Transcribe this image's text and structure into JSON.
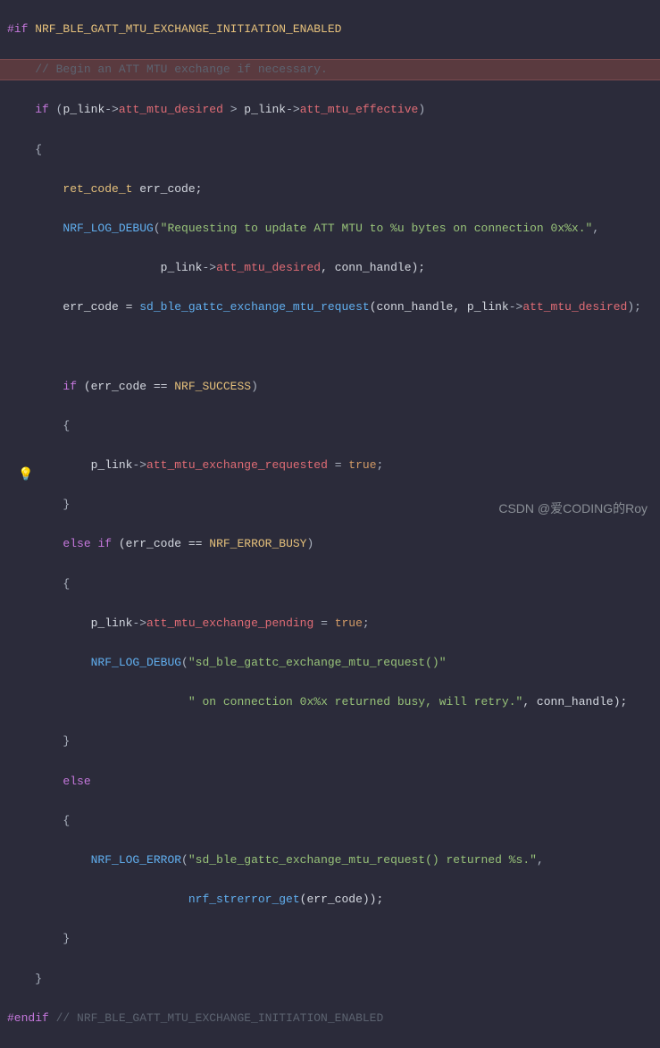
{
  "watermark": "CSDN @爱CODING的Roy",
  "gutter": {
    "bulb": "💡"
  },
  "code": {
    "l1": {
      "pp": "#if",
      "name": " NRF_BLE_GATT_MTU_EXCHANGE_INITIATION_ENABLED"
    },
    "l2": "    // Begin an ATT MTU exchange if necessary.",
    "l3": {
      "kw": "if",
      "open": " (",
      "p1": "p_link",
      "arrow1": "->",
      "m1": "att_mtu_desired",
      "op": " > ",
      "p2": "p_link",
      "arrow2": "->",
      "m2": "att_mtu_effective",
      "close": ")"
    },
    "l4": "    {",
    "l5": {
      "type": "ret_code_t",
      "var": " err_code;"
    },
    "l6": {
      "fn": "NRF_LOG_DEBUG",
      "open": "(",
      "str": "\"Requesting to update ATT MTU to %u bytes on connection 0x%x.\"",
      "comma": ","
    },
    "l7": {
      "p": "p_link",
      "arrow": "->",
      "m": "att_mtu_desired",
      "rest": ", conn_handle);"
    },
    "l8": {
      "lhs": "err_code = ",
      "fn": "sd_ble_gattc_exchange_mtu_request",
      "open": "(conn_handle, ",
      "p": "p_link",
      "arrow": "->",
      "m": "att_mtu_desired",
      "close": ");"
    },
    "l9": "",
    "l10": {
      "kw": "if",
      "open": " (err_code == ",
      "c": "NRF_SUCCESS",
      "close": ")"
    },
    "l11": "        {",
    "l12": {
      "p": "p_link",
      "arrow": "->",
      "m": "att_mtu_exchange_requested",
      "eq": " = ",
      "v": "true",
      "end": ";"
    },
    "l13": "        }",
    "l14": {
      "kw1": "else",
      "kw2": " if",
      "open": " (err_code == ",
      "c": "NRF_ERROR_BUSY",
      "close": ")"
    },
    "l15": "        {",
    "l16": {
      "p": "p_link",
      "arrow": "->",
      "m": "att_mtu_exchange_pending",
      "eq": " = ",
      "v": "true",
      "end": ";"
    },
    "l17": {
      "fn": "NRF_LOG_DEBUG",
      "open": "(",
      "str": "\"sd_ble_gattc_exchange_mtu_request()\""
    },
    "l18": {
      "str": "\" on connection 0x%x returned busy, will retry.\"",
      "rest": ", conn_handle);"
    },
    "l19": "        }",
    "l20": {
      "kw": "else"
    },
    "l21": "        {",
    "l22": {
      "fn": "NRF_LOG_ERROR",
      "open": "(",
      "str": "\"sd_ble_gattc_exchange_mtu_request() returned %s.\"",
      "comma": ","
    },
    "l23": {
      "fn": "nrf_strerror_get",
      "open": "(err_code));"
    },
    "l24": "        }",
    "l25": "    }",
    "l26": {
      "pp": "#endif",
      "cmt": " // NRF_BLE_GATT_MTU_EXCHANGE_INITIATION_ENABLED"
    }
  }
}
